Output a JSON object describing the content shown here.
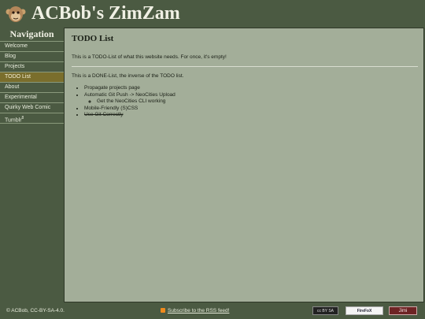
{
  "header": {
    "title": "ACBob's ZimZam",
    "logo_icon": "monkey-face-icon"
  },
  "sidebar": {
    "heading": "Navigation",
    "items": [
      {
        "label": "Welcome"
      },
      {
        "label": "Blog"
      },
      {
        "label": "Projects"
      },
      {
        "label": "TODO List",
        "active": true
      },
      {
        "label": "About"
      },
      {
        "label": "Experimental"
      },
      {
        "label": "Quirky Web Comic"
      },
      {
        "label": "Tumblr",
        "superscript": "8"
      }
    ]
  },
  "main": {
    "title": "TODO List",
    "todo_text": "This is a TODO-List of what this website needs. For once, it's empty!",
    "done_text": "This is a DONE-List, the inverse of the TODO list.",
    "done_items": [
      "Propagate projects page",
      "Automatic Git Push -> NeoCities Upload",
      "Get the NeoCities CLI working",
      "Mobile-Friendly (S)CSS",
      "Use Git Correctly"
    ]
  },
  "footer": {
    "copyright": "© ACBob, CC-BY-SA-4.0.",
    "rss_link": "Subscribe to the RSS feed!",
    "rss_icon": "rss-icon",
    "badges": {
      "cc": "cc BY SA",
      "firefox": "FireFoX",
      "jimdo": "Jimi"
    }
  },
  "colors": {
    "background": "#4b5a42",
    "content": "#a3ae99",
    "active_nav": "#7a6e2c"
  }
}
